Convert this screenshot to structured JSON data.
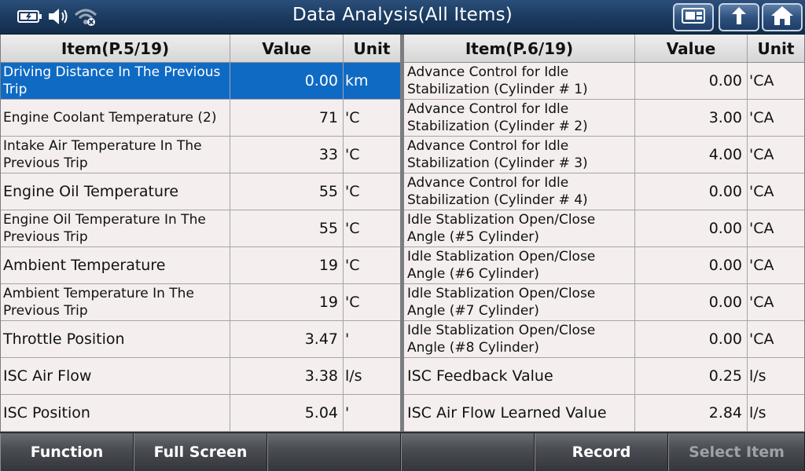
{
  "title": "Data Analysis(All Items)",
  "toolbar": {
    "icons": [
      "battery-icon",
      "speaker-icon",
      "wifi-icon"
    ],
    "buttons": [
      "print-icon",
      "back-icon",
      "home-icon"
    ]
  },
  "left_table": {
    "headers": {
      "item": "Item(P.5/19)",
      "value": "Value",
      "unit": "Unit"
    },
    "rows": [
      {
        "item": "Driving Distance In The Previous Trip",
        "value": "0.00",
        "unit": "km",
        "selected": true
      },
      {
        "item": "Engine Coolant Temperature (2)",
        "value": "71",
        "unit": "'C"
      },
      {
        "item": "Intake Air Temperature In The Previous Trip",
        "value": "33",
        "unit": "'C"
      },
      {
        "item": "Engine Oil Temperature",
        "value": "55",
        "unit": "'C"
      },
      {
        "item": "Engine Oil Temperature In The Previous Trip",
        "value": "55",
        "unit": "'C"
      },
      {
        "item": "Ambient Temperature",
        "value": "19",
        "unit": "'C"
      },
      {
        "item": "Ambient Temperature In The Previous Trip",
        "value": "19",
        "unit": "'C"
      },
      {
        "item": "Throttle Position",
        "value": "3.47",
        "unit": "'"
      },
      {
        "item": "ISC Air Flow",
        "value": "3.38",
        "unit": "l/s"
      },
      {
        "item": "ISC Position",
        "value": "5.04",
        "unit": "'"
      }
    ]
  },
  "right_table": {
    "headers": {
      "item": "Item(P.6/19)",
      "value": "Value",
      "unit": "Unit"
    },
    "rows": [
      {
        "item": "Advance Control for Idle Stabilization (Cylinder # 1)",
        "value": "0.00",
        "unit": "'CA"
      },
      {
        "item": "Advance Control for Idle Stabilization (Cylinder # 2)",
        "value": "3.00",
        "unit": "'CA"
      },
      {
        "item": "Advance Control for Idle Stabilization (Cylinder # 3)",
        "value": "4.00",
        "unit": "'CA"
      },
      {
        "item": "Advance Control for Idle Stabilization (Cylinder # 4)",
        "value": "0.00",
        "unit": "'CA"
      },
      {
        "item": "Idle Stablization Open/Close Angle (#5 Cylinder)",
        "value": "0.00",
        "unit": "'CA"
      },
      {
        "item": "Idle Stablization Open/Close Angle (#6 Cylinder)",
        "value": "0.00",
        "unit": "'CA"
      },
      {
        "item": "Idle Stablization Open/Close Angle (#7 Cylinder)",
        "value": "0.00",
        "unit": "'CA"
      },
      {
        "item": "Idle Stablization Open/Close Angle (#8 Cylinder)",
        "value": "0.00",
        "unit": "'CA"
      },
      {
        "item": "ISC Feedback Value",
        "value": "0.25",
        "unit": "l/s"
      },
      {
        "item": "ISC Air Flow Learned Value",
        "value": "2.84",
        "unit": "l/s"
      }
    ]
  },
  "bottom_buttons": [
    {
      "label": "Function",
      "enabled": true
    },
    {
      "label": "Full Screen",
      "enabled": true
    },
    {
      "label": "",
      "enabled": true
    },
    {
      "label": "",
      "enabled": true
    },
    {
      "label": "Record",
      "enabled": true
    },
    {
      "label": "Select Item",
      "enabled": false
    }
  ]
}
